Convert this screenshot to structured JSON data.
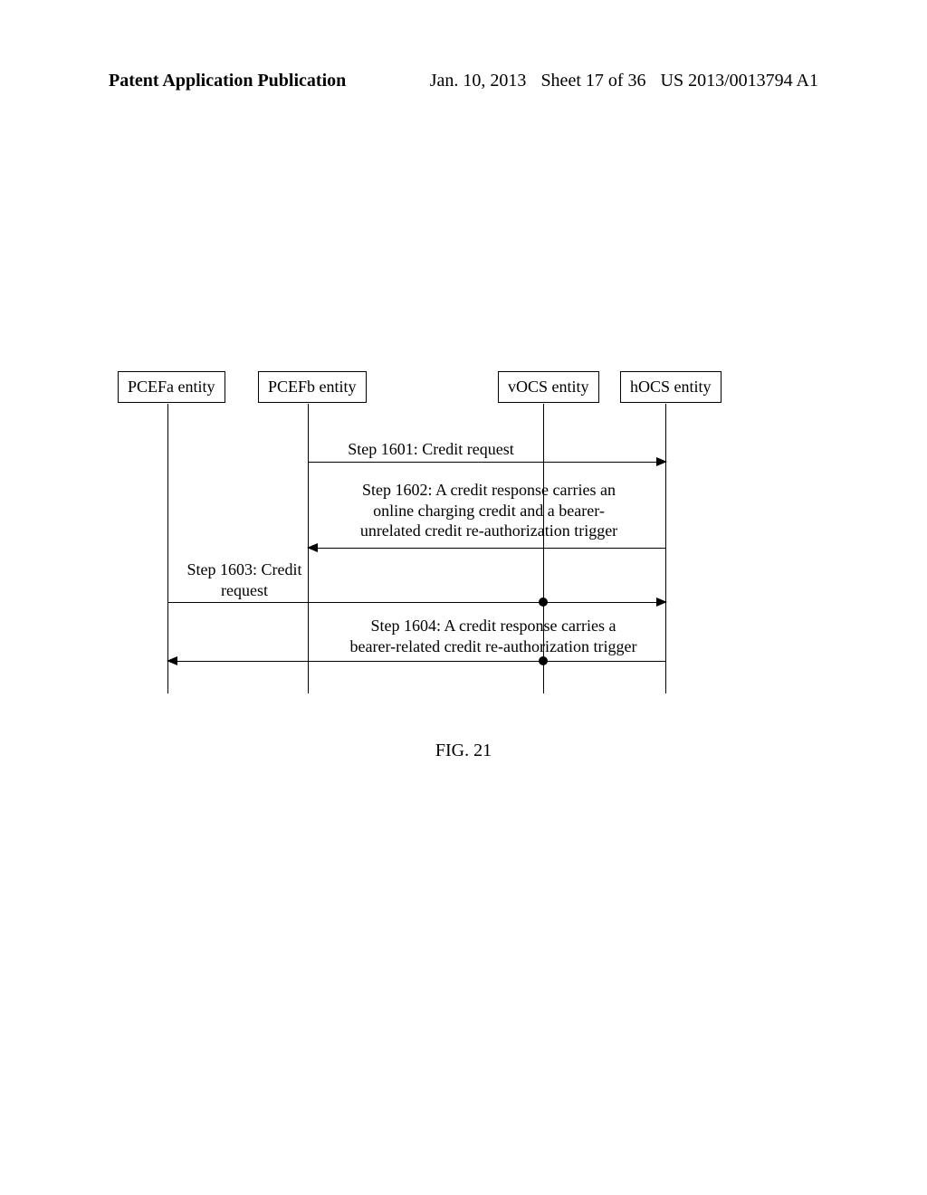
{
  "header": {
    "left": "Patent Application Publication",
    "date": "Jan. 10, 2013",
    "sheet": "Sheet 17 of 36",
    "pubnum": "US 2013/0013794 A1"
  },
  "entities": {
    "pcefa": "PCEFa entity",
    "pcefb": "PCEFb entity",
    "vocs": "vOCS entity",
    "hocs": "hOCS entity"
  },
  "messages": {
    "m1601": "Step 1601: Credit request",
    "m1602_l1": "Step 1602: A credit response carries an",
    "m1602_l2": "online charging credit and a bearer-",
    "m1602_l3": "unrelated credit re-authorization trigger",
    "m1603_l1": "Step 1603: Credit",
    "m1603_l2": "request",
    "m1604_l1": "Step 1604: A credit response carries a",
    "m1604_l2": "bearer-related credit re-authorization trigger"
  },
  "figure_caption": "FIG. 21"
}
